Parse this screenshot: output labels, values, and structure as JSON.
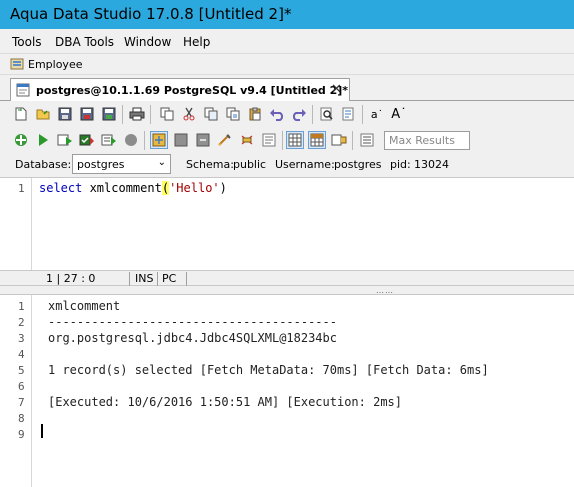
{
  "window": {
    "title": "Aqua Data Studio 17.0.8 [Untitled 2]*"
  },
  "menu": [
    {
      "label": "Tools"
    },
    {
      "label": "DBA Tools"
    },
    {
      "label": "Window"
    },
    {
      "label": "Help"
    }
  ],
  "connection": {
    "label": "Employee"
  },
  "tab": {
    "label": "postgres@10.1.1.69 PostgreSQL  v9.4 [Untitled 2]*",
    "close": "✕"
  },
  "toolbar": {
    "max_results_placeholder": "Max Results",
    "font_small": "a˙",
    "font_large": "A˙"
  },
  "dbbar": {
    "database_label": "Database:",
    "database_value": "postgres",
    "schema_label": "Schema:",
    "schema_value": "public",
    "username_label": "Username:",
    "username_value": "postgres",
    "pid_label": "pid:",
    "pid_value": "13024"
  },
  "editor": {
    "line_number": "1",
    "kw": "select",
    "fn": " xmlcomment",
    "open": "(",
    "str": "'Hello'",
    "close": ")"
  },
  "status": {
    "position": "1 | 27 : 0",
    "ins": "INS",
    "pc": "PC"
  },
  "results": {
    "lines": [
      {
        "num": "1",
        "text": "xmlcomment"
      },
      {
        "num": "2",
        "text": "----------------------------------------"
      },
      {
        "num": "3",
        "text": "org.postgresql.jdbc4.Jdbc4SQLXML@18234bc"
      },
      {
        "num": "4",
        "text": ""
      },
      {
        "num": "5",
        "text": "1 record(s) selected [Fetch MetaData: 70ms] [Fetch Data: 6ms]"
      },
      {
        "num": "6",
        "text": ""
      },
      {
        "num": "7",
        "text": "[Executed: 10/6/2016 1:50:51 AM] [Execution: 2ms]"
      },
      {
        "num": "8",
        "text": ""
      },
      {
        "num": "9",
        "text": ""
      }
    ]
  }
}
